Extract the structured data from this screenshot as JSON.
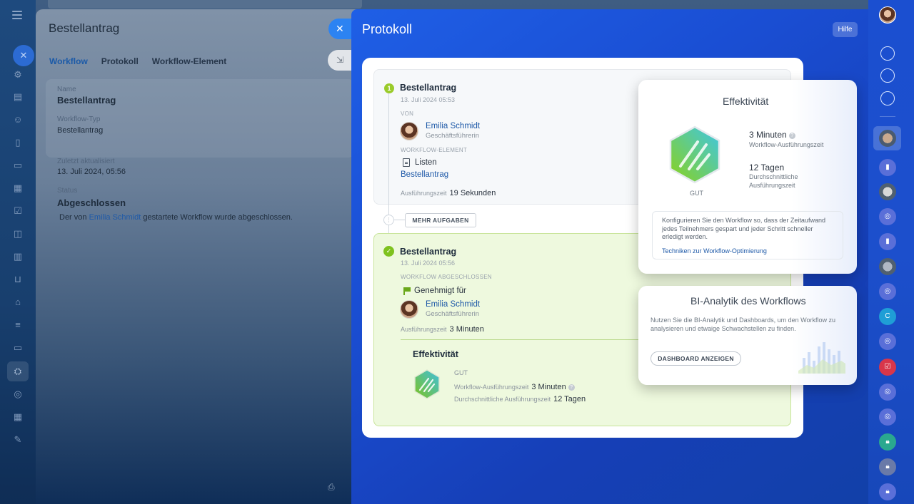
{
  "left_panel": {
    "title": "Bestellantrag",
    "tabs": [
      {
        "label": "Workflow",
        "active": true
      },
      {
        "label": "Protokoll",
        "active": false
      },
      {
        "label": "Workflow-Element",
        "active": false
      }
    ],
    "name_label": "Name",
    "name_value": "Bestellantrag",
    "type_label": "Workflow-Typ",
    "type_value": "Bestellantrag",
    "updated_label": "Zuletzt aktualisiert",
    "updated_value": "13. Juli 2024, 05:56",
    "status_label": "Status",
    "status_value": "Abgeschlossen",
    "message_prefix": "Der von",
    "message_link": "Emilia Schmidt",
    "message_suffix": "gestartete Workflow wurde abgeschlossen."
  },
  "main_panel": {
    "title": "Protokoll",
    "help_label": "Hilfe"
  },
  "step1": {
    "number": "1",
    "title": "Bestellantrag",
    "date": "13. Juli 2024 05:53",
    "from_caption": "VON",
    "user_name": "Emilia Schmidt",
    "user_role": "Geschäftsführerin",
    "element_caption": "WORKFLOW-ELEMENT",
    "element_type": "Listen",
    "element_link": "Bestellantrag",
    "exec_label": "Ausführungszeit",
    "exec_value": "19 Sekunden"
  },
  "more_tasks_label": "MEHR AUFGABEN",
  "step2": {
    "title": "Bestellantrag",
    "date": "13. Juli 2024 05:56",
    "status_caption": "WORKFLOW ABGESCHLOSSEN",
    "approved_label": "Genehmigt für",
    "user_name": "Emilia Schmidt",
    "user_role": "Geschäftsführerin",
    "exec_label": "Ausführungszeit",
    "exec_value": "3 Minuten",
    "eff_title": "Effektivität",
    "eff_rating": "GUT",
    "eff_run_label": "Workflow-Ausführungszeit",
    "eff_run_value": "3 Minuten",
    "eff_avg_label": "Durchschnittliche Ausführungszeit",
    "eff_avg_value": "12 Tagen"
  },
  "eff_popup": {
    "title": "Effektivität",
    "rating": "GUT",
    "run_value": "3 Minuten",
    "run_label": "Workflow-Ausführungszeit",
    "avg_value": "12 Tagen",
    "avg_label_1": "Durchschnittliche",
    "avg_label_2": "Ausführungszeit",
    "tip_text": "Konfigurieren Sie den Workflow so, dass der Zeitaufwand jedes Teilnehmers gespart und jeder Schritt schneller erledigt werden.",
    "tip_link": "Techniken zur Workflow-Optimierung"
  },
  "bi_popup": {
    "title": "BI-Analytik des Workflows",
    "text": "Nutzen Sie die BI-Analytik und Dashboards, um den Workflow zu analysieren und etwaige Schwachstellen zu finden.",
    "button_label": "DASHBOARD ANZEIGEN"
  },
  "colors": {
    "accent_blue": "#1f5fe6",
    "success_green": "#7ec21e",
    "link_blue": "#1f5aa8"
  }
}
